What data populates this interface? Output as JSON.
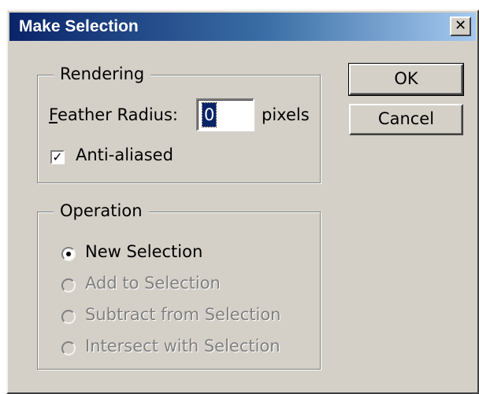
{
  "window": {
    "title": "Make Selection",
    "close_glyph": "✕",
    "close_icon": "close-icon"
  },
  "rendering": {
    "legend": "Rendering",
    "feather_label": "Feather Radius:",
    "feather_value": "0",
    "unit": "pixels",
    "antialiased_label": "Anti-aliased",
    "antialiased_checked": true
  },
  "operation": {
    "legend": "Operation",
    "options": [
      {
        "label": "New Selection",
        "selected": true,
        "enabled": true
      },
      {
        "label": "Add to Selection",
        "selected": false,
        "enabled": false
      },
      {
        "label": "Subtract from Selection",
        "selected": false,
        "enabled": false
      },
      {
        "label": "Intersect with Selection",
        "selected": false,
        "enabled": false
      }
    ]
  },
  "buttons": {
    "ok": "OK",
    "cancel": "Cancel"
  },
  "colors": {
    "titlebar_start": "#0a246a",
    "titlebar_end": "#a6caf0",
    "dialog_bg": "#d4d0c8",
    "disabled_text": "#808080"
  }
}
